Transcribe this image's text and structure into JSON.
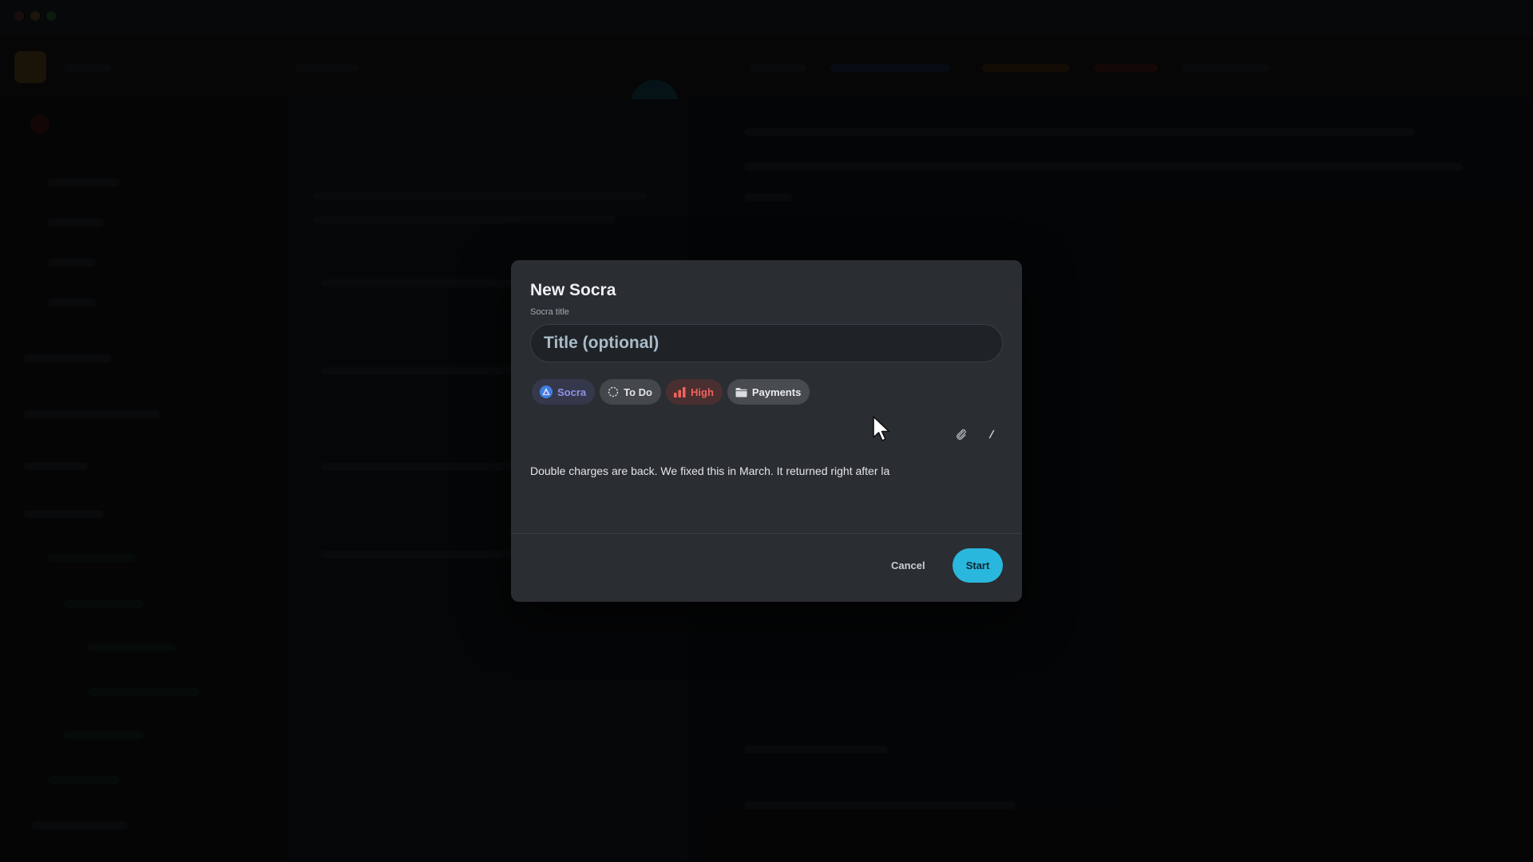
{
  "modal": {
    "title": "New Socra",
    "field_label": "Socra title",
    "title_placeholder": "Title (optional)",
    "title_value": "",
    "chips": {
      "agent": "Socra",
      "status": "To Do",
      "priority": "High",
      "project": "Payments"
    },
    "tools": {
      "attach_icon": "paperclip-icon",
      "command_icon": "slash-icon"
    },
    "body_text": "Double charges are back. We fixed this in March. It returned right after la",
    "cancel_label": "Cancel",
    "start_label": "Start"
  },
  "colors": {
    "accent": "#2ab7de",
    "modal_bg": "#2a2d31",
    "priority_high": "#f0645c",
    "agent_chip": "#8f92e8"
  }
}
